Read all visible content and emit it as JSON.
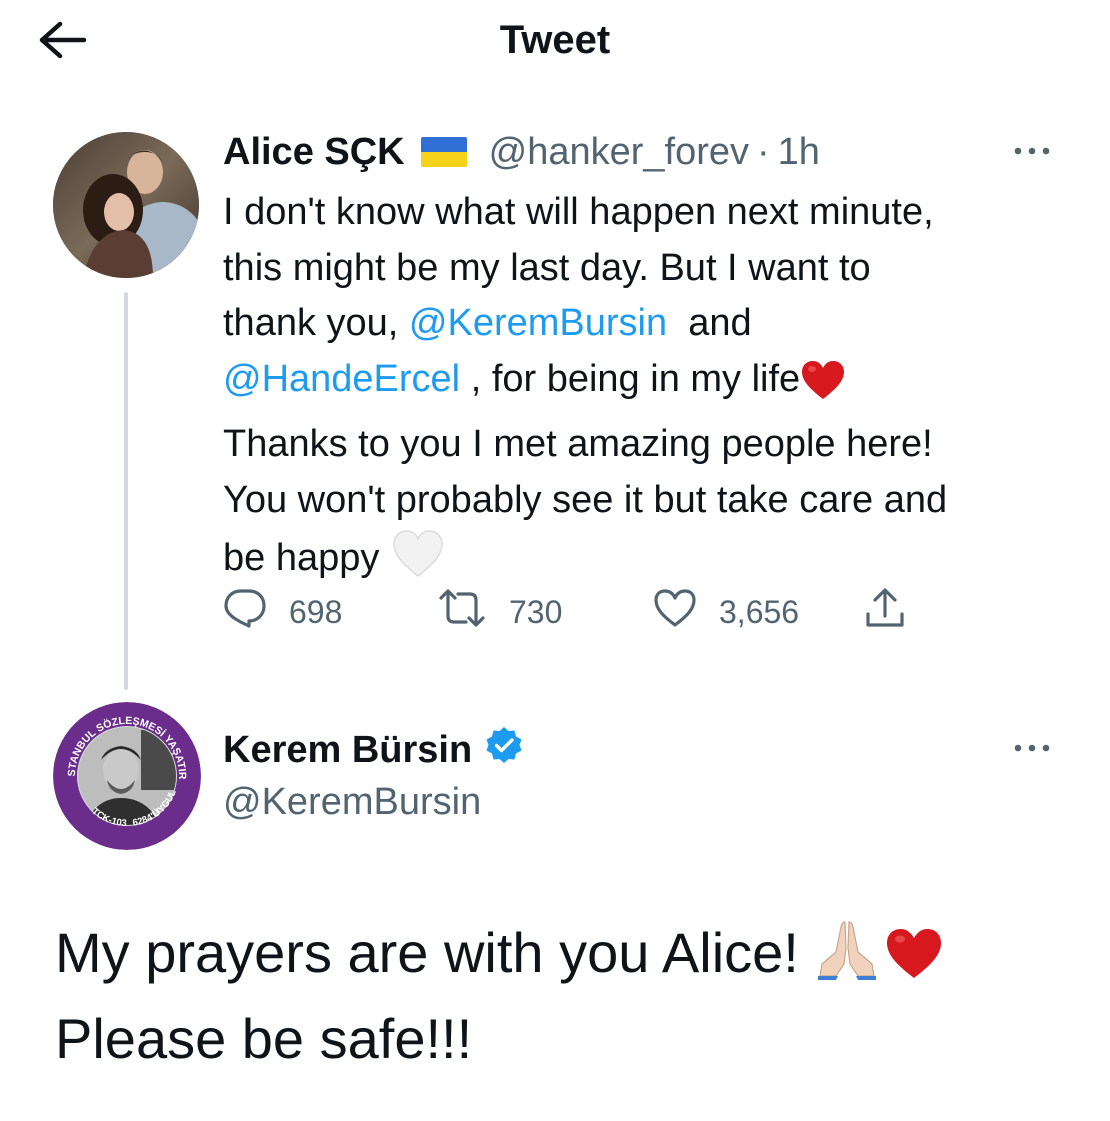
{
  "header": {
    "title": "Tweet",
    "back_icon": "arrow-left-icon"
  },
  "tweet1": {
    "name": "Alice SÇK",
    "flag": "ukraine-flag-icon",
    "handle": "@hanker_forev",
    "separator": "·",
    "time": "1h",
    "more_icon": "more-horizontal-icon",
    "text": {
      "line1": "I don't know what will happen next minute,",
      "line2": "this might be my last day. But I want to",
      "line3_pre": "thank you, ",
      "mention1": "@KeremBursin",
      "line3_post": "  and",
      "mention2": "@HandeErcel",
      "line4_post": " , for being in my life",
      "line5": "Thanks to you I met amazing people here!",
      "line6": "You won't probably see it but take care and",
      "line7": "be happy "
    },
    "stats": {
      "replies": "698",
      "retweets": "730",
      "likes": "3,656"
    }
  },
  "tweet2": {
    "name": "Kerem Bürsin",
    "verified_icon": "verified-badge-icon",
    "handle": "@KeremBursin",
    "more_icon": "more-horizontal-icon",
    "avatar_ring_text": {
      "top": "İSTANBUL SÖZLEŞMESİ YAŞATIR",
      "bottom_right": "UYGULA",
      "bottom": "6284'Ü",
      "left": "TCK-103"
    },
    "text": {
      "line1": "My prayers are with you Alice! ",
      "line2": "Please be safe!!!"
    }
  },
  "colors": {
    "text": "#0f1419",
    "secondary": "#536471",
    "accent": "#1d9bf0",
    "thread_line": "#cfd9de",
    "heart": "#d7191f",
    "avatar_ring": "#6b2d8c"
  }
}
